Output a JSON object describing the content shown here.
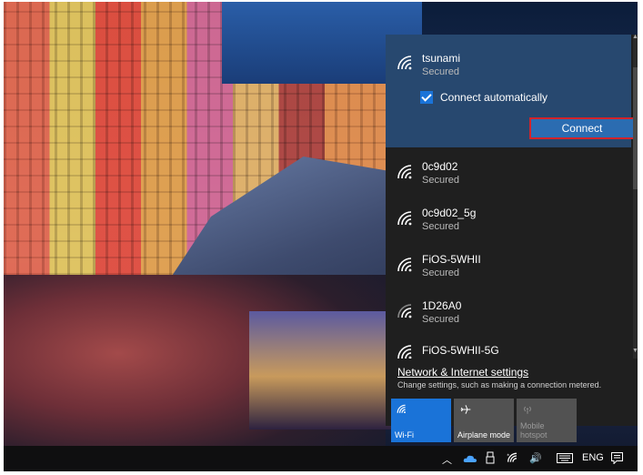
{
  "wifi_panel": {
    "selected_network": {
      "name": "tsunami",
      "status": "Secured",
      "connect_automatically_label": "Connect automatically",
      "connect_automatically_checked": true,
      "connect_button_label": "Connect"
    },
    "networks": [
      {
        "name": "0c9d02",
        "status": "Secured"
      },
      {
        "name": "0c9d02_5g",
        "status": "Secured"
      },
      {
        "name": "FiOS-5WHII",
        "status": "Secured"
      },
      {
        "name": "1D26A0",
        "status": "Secured"
      },
      {
        "name": "FiOS-5WHII-5G",
        "status": ""
      }
    ],
    "settings_link": "Network & Internet settings",
    "settings_description": "Change settings, such as making a connection metered.",
    "quick_actions": [
      {
        "label": "Wi-Fi",
        "sublabel": "",
        "active": true,
        "icon": "wifi-icon"
      },
      {
        "label": "Airplane mode",
        "sublabel": "",
        "active": false,
        "icon": "airplane-icon"
      },
      {
        "label": "hotspot",
        "sublabel": "Mobile",
        "active": false,
        "icon": "hotspot-icon"
      }
    ]
  },
  "taskbar": {
    "language": "ENG",
    "icons": [
      "chevron-up-icon",
      "onedrive-icon",
      "usb-icon",
      "wifi-icon",
      "volume-icon",
      "keyboard-icon",
      "action-center-icon"
    ]
  },
  "colors": {
    "selected_bg": "#27486f",
    "connect_button": "#2b6cb1",
    "connect_highlight": "#d2232a",
    "wifi_tile_active": "#1a73d8",
    "tile_inactive": "#525252",
    "panel_bg": "#1f1f1f"
  }
}
